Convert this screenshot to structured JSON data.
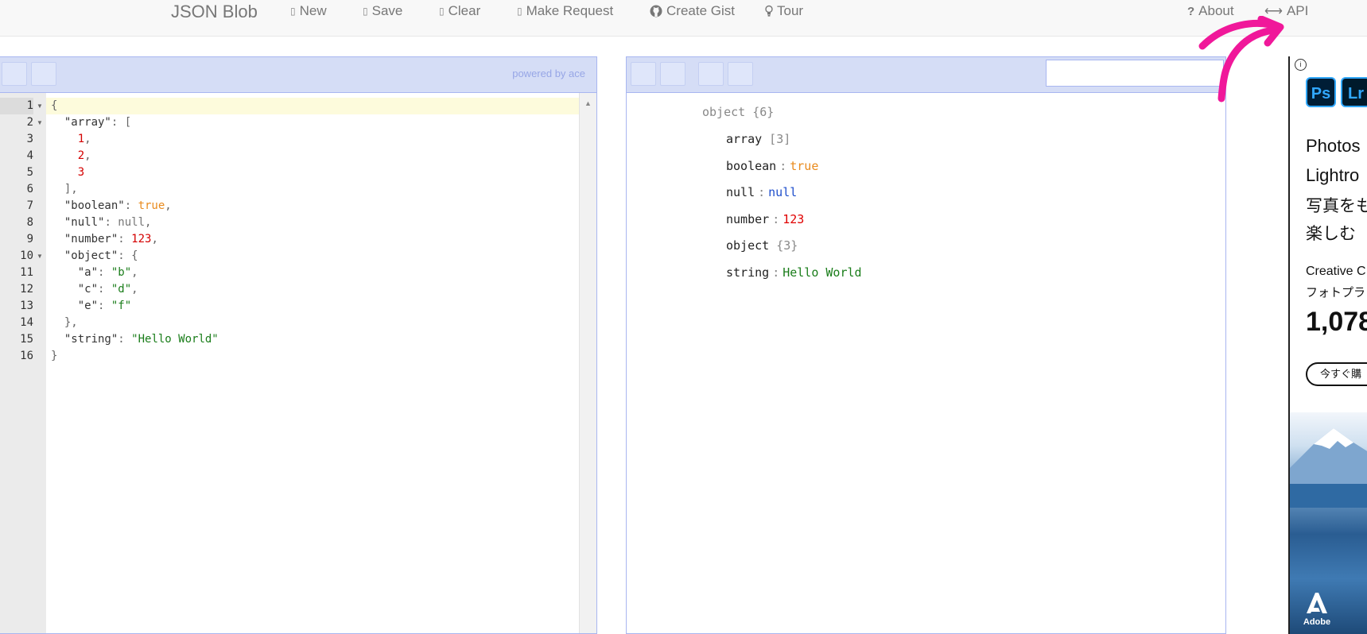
{
  "navbar": {
    "brand": "JSON Blob",
    "items": [
      {
        "label": "New",
        "icon": "file-icon"
      },
      {
        "label": "Save",
        "icon": "save-icon"
      },
      {
        "label": "Clear",
        "icon": "trash-icon"
      },
      {
        "label": "Make Request",
        "icon": "request-icon"
      },
      {
        "label": "Create Gist",
        "icon": "github-icon"
      },
      {
        "label": "Tour",
        "icon": "lightbulb-icon"
      }
    ],
    "right_items": [
      {
        "label": "About",
        "icon": "question-icon",
        "glyph": "?"
      },
      {
        "label": "API",
        "icon": "arrows-horizontal-icon",
        "glyph": "⟷"
      }
    ]
  },
  "editor": {
    "powered_by": "powered by ace",
    "line_numbers": [
      "1",
      "2",
      "3",
      "4",
      "5",
      "6",
      "7",
      "8",
      "9",
      "10",
      "11",
      "12",
      "13",
      "14",
      "15",
      "16"
    ],
    "active_line": "1"
  },
  "tree": {
    "root_key": "object",
    "root_type": "{6}",
    "rows": [
      {
        "key": "array",
        "type": "[3]",
        "kind": "container"
      },
      {
        "key": "boolean",
        "sep": ":",
        "value": "true",
        "kind": "bool"
      },
      {
        "key": "null",
        "sep": ":",
        "value": "null",
        "kind": "null"
      },
      {
        "key": "number",
        "sep": ":",
        "value": "123",
        "kind": "num"
      },
      {
        "key": "object",
        "type": "{3}",
        "kind": "container"
      },
      {
        "key": "string",
        "sep": ":",
        "value": "Hello World",
        "kind": "str"
      }
    ]
  },
  "annotation": {
    "color": "#f0189a"
  },
  "ad": {
    "apps": [
      "Ps",
      "Lr"
    ],
    "line1": "Photos",
    "line2": "Lightro",
    "line3": "写真をも",
    "line4": "楽しむ",
    "line5": "Creative C",
    "line6": "フォトプラ",
    "price": "1,078",
    "cta": "今すぐ購",
    "brand": "Adobe"
  }
}
